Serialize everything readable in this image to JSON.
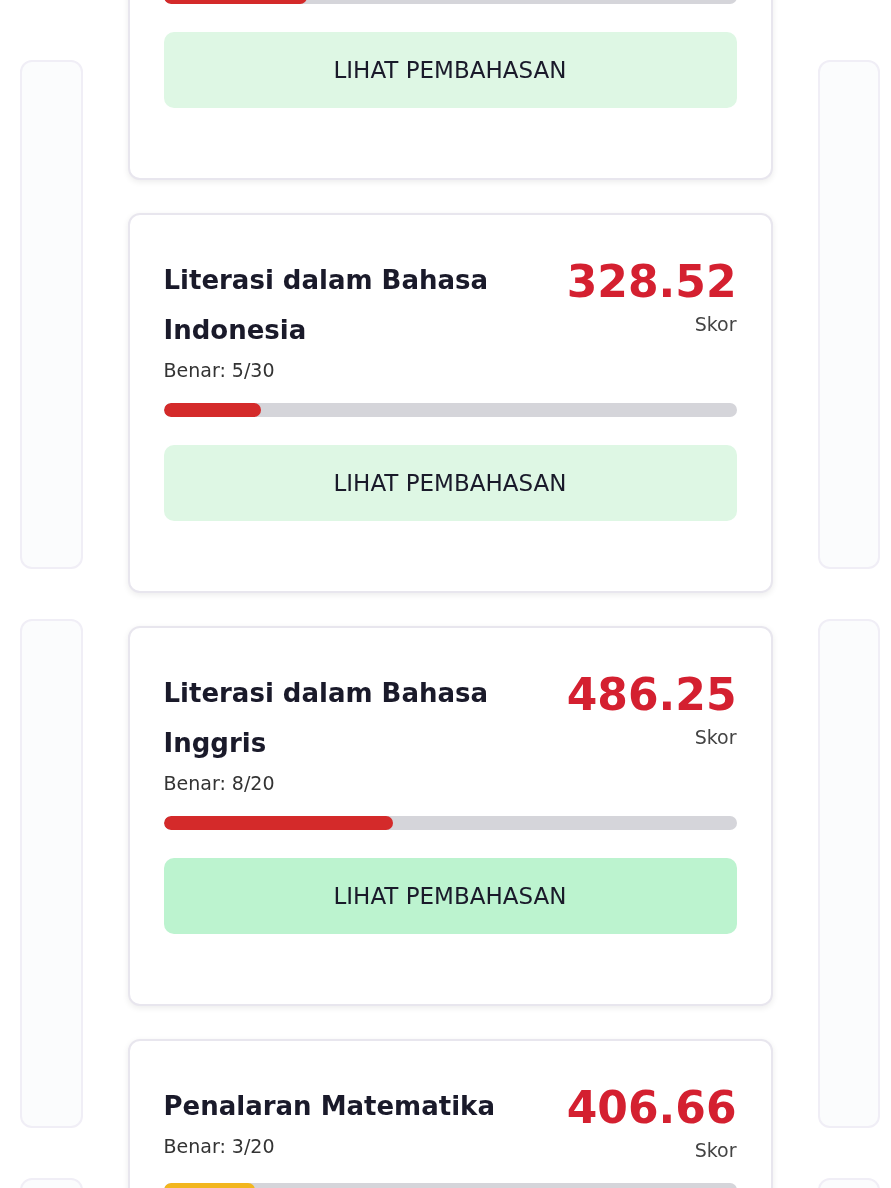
{
  "cards": [
    {
      "progress": {
        "level": 0.25,
        "color": "#d42a2a"
      },
      "button": {
        "label": "LIHAT PEMBAHASAN",
        "highlighted": false
      }
    },
    {
      "title": "Literasi dalam Bahasa Indonesia",
      "correct": "Benar: 5/30",
      "score": "328.52",
      "score_label": "Skor",
      "progress": {
        "level": 0.17,
        "color": "#d42a2a"
      },
      "button": {
        "label": "LIHAT PEMBAHASAN",
        "highlighted": false
      }
    },
    {
      "title": "Literasi dalam Bahasa Inggris",
      "correct": "Benar: 8/20",
      "score": "486.25",
      "score_label": "Skor",
      "progress": {
        "level": 0.4,
        "color": "#d42a2a"
      },
      "button": {
        "label": "LIHAT PEMBAHASAN",
        "highlighted": true
      }
    },
    {
      "title": "Penalaran Matematika",
      "correct": "Benar: 3/20",
      "score": "406.66",
      "score_label": "Skor",
      "progress": {
        "level": 0.16,
        "color": "#f2b61e"
      }
    }
  ]
}
